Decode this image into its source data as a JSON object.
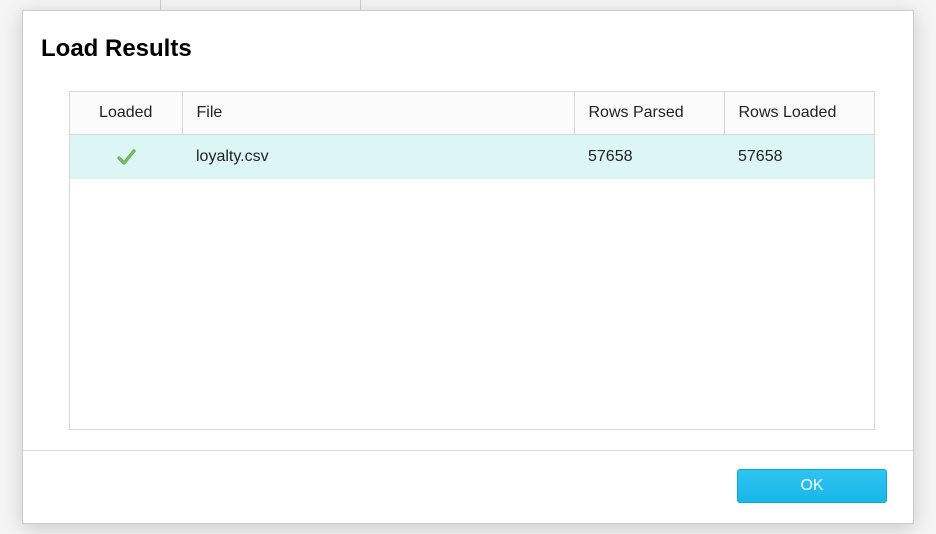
{
  "dialog": {
    "title": "Load Results",
    "ok_label": "OK"
  },
  "table": {
    "headers": {
      "loaded": "Loaded",
      "file": "File",
      "rows_parsed": "Rows Parsed",
      "rows_loaded": "Rows Loaded"
    },
    "rows": [
      {
        "loaded_icon": "checkmark",
        "file": "loyalty.csv",
        "rows_parsed": "57658",
        "rows_loaded": "57658"
      }
    ]
  }
}
